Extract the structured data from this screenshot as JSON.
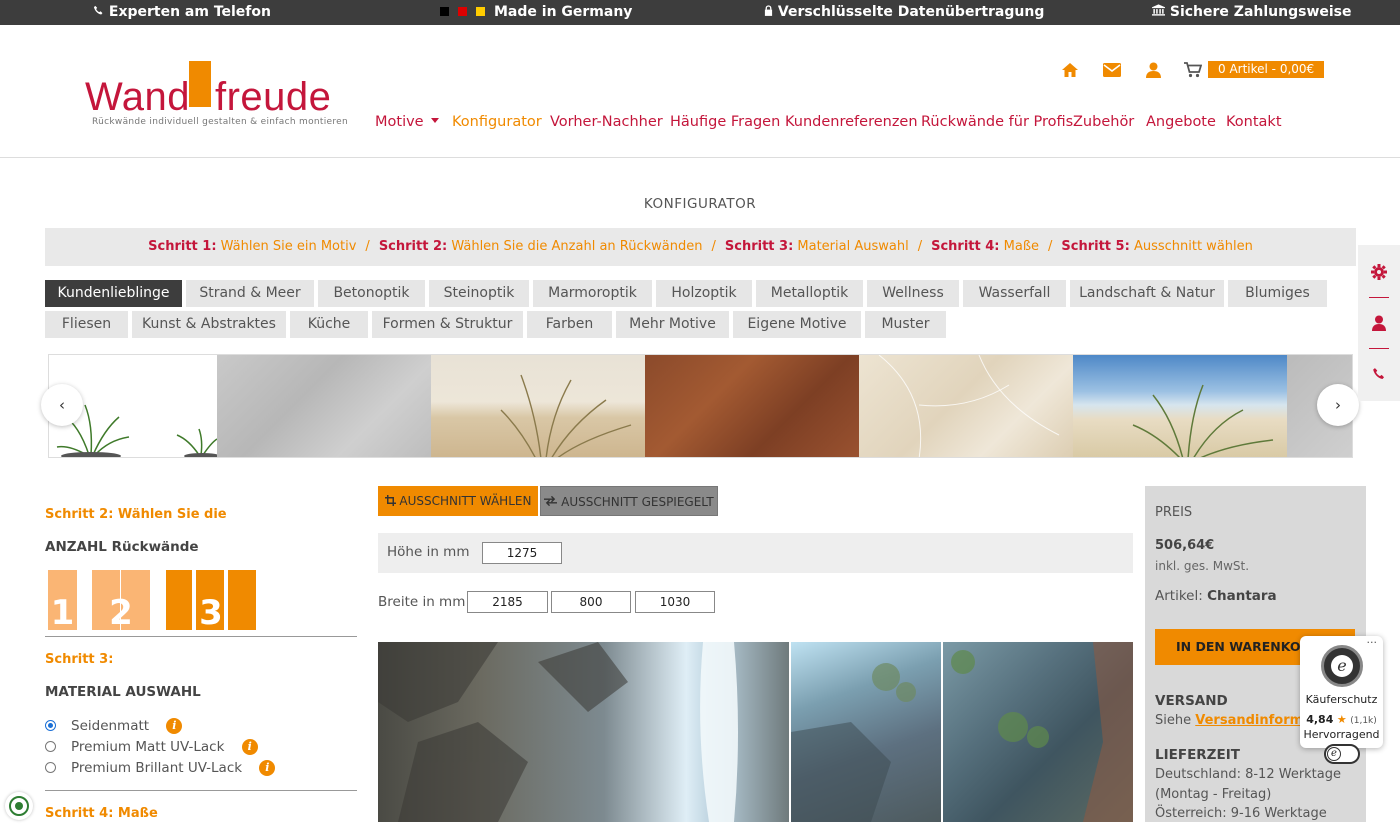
{
  "topbar": {
    "phone": "Experten am Telefon",
    "made": "Made in Germany",
    "secure": "Verschlüsselte Datenübertragung",
    "payment": "Sichere Zahlungsweise"
  },
  "logo": {
    "part1": "Wand",
    "part2": "freude",
    "tagline": "Rückwände individuell gestalten & einfach montieren"
  },
  "cart": {
    "label": "0 Artikel - 0,00€"
  },
  "nav": [
    {
      "label": "Motive"
    },
    {
      "label": "Konfigurator"
    },
    {
      "label": "Vorher-Nachher"
    },
    {
      "label": "Häufige Fragen"
    },
    {
      "label": "Kundenreferenzen"
    },
    {
      "label": "Rückwände für Profis"
    },
    {
      "label": "Zubehör"
    },
    {
      "label": "Angebote"
    },
    {
      "label": "Kontakt"
    }
  ],
  "page_title": "KONFIGURATOR",
  "steps": [
    {
      "num": "Schritt 1:",
      "text": "Wählen Sie ein Motiv"
    },
    {
      "num": "Schritt 2:",
      "text": "Wählen Sie die Anzahl an Rückwänden"
    },
    {
      "num": "Schritt 3:",
      "text": "Material Auswahl"
    },
    {
      "num": "Schritt 4:",
      "text": "Maße"
    },
    {
      "num": "Schritt 5:",
      "text": "Ausschnitt wählen"
    }
  ],
  "categories_row1": [
    "Kundenlieblinge",
    "Strand & Meer",
    "Betonoptik",
    "Steinoptik",
    "Marmoroptik",
    "Holzoptik",
    "Metalloptik",
    "Wellness",
    "Wasserfall",
    "Landschaft & Natur",
    "Blumiges"
  ],
  "categories_row2": [
    "Fliesen",
    "Kunst & Abstraktes",
    "Küche",
    "Formen & Struktur",
    "Farben",
    "Mehr Motive",
    "Eigene Motive",
    "Muster"
  ],
  "active_category": "Kundenlieblinge",
  "step2": {
    "heading": "Schritt 2: Wählen Sie die",
    "sub": "ANZAHL Rückwände",
    "panels": [
      "1",
      "2",
      "3"
    ],
    "selected": "3"
  },
  "step3": {
    "heading": "Schritt 3:",
    "sub": "MATERIAL AUSWAHL",
    "options": [
      {
        "label": "Seidenmatt",
        "selected": true
      },
      {
        "label": "Premium Matt UV-Lack",
        "selected": false
      },
      {
        "label": "Premium Brillant UV-Lack",
        "selected": false
      }
    ]
  },
  "step4": {
    "heading": "Schritt 4: Maße"
  },
  "tools": {
    "crop_label": "AUSSCHNITT WÄHLEN",
    "mirror_label": "AUSSCHNITT GESPIEGELT"
  },
  "dimensions": {
    "height_label": "Höhe in mm",
    "height_value": "1275",
    "width_label": "Breite in mm",
    "width_values": [
      "2185",
      "800",
      "1030"
    ]
  },
  "price": {
    "label": "PREIS",
    "amount": "506,64€",
    "tax": "inkl. ges. MwSt.",
    "article_label": "Artikel:",
    "article_name": "Chantara",
    "cart_button": "IN DEN WARENKORB",
    "shipping_title": "VERSAND",
    "shipping_prefix": "Siehe",
    "shipping_link": "Versandinformationen",
    "delivery_title": "LIEFERZEIT",
    "delivery_de": "Deutschland: 8-12 Werktage",
    "delivery_de_note": "(Montag - Freitag)",
    "delivery_at": "Österreich: 9-16 Werktage"
  },
  "trust": {
    "label": "Käuferschutz",
    "rating": "4,84",
    "count": "(1,1k)",
    "verdict": "Hervorragend"
  },
  "colors": {
    "accent": "#f08a00",
    "brand": "#c4163b",
    "dark": "#3d3d3d"
  }
}
